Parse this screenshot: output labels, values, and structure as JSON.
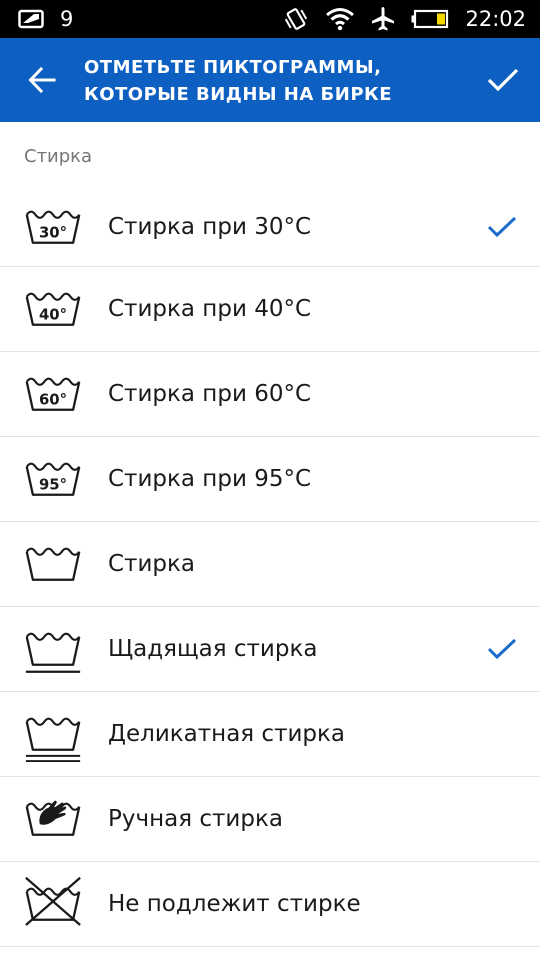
{
  "status_bar": {
    "notification_count": "9",
    "time": "22:02"
  },
  "app_bar": {
    "title_line1": "ОТМЕТЬТЕ ПИКТОГРАММЫ,",
    "title_line2": "КОТОРЫЕ ВИДНЫ НА БИРКЕ",
    "accent_color": "#0d5fc2",
    "check_color": "#1a6ccc"
  },
  "section": {
    "title": "Стирка"
  },
  "items": [
    {
      "label": "Стирка при 30°C",
      "icon": "wash-30-icon",
      "temp": "30°",
      "checked": true
    },
    {
      "label": "Стирка при 40°C",
      "icon": "wash-40-icon",
      "temp": "40°",
      "checked": false
    },
    {
      "label": "Стирка при 60°C",
      "icon": "wash-60-icon",
      "temp": "60°",
      "checked": false
    },
    {
      "label": "Стирка при 95°C",
      "icon": "wash-95-icon",
      "temp": "95°",
      "checked": false
    },
    {
      "label": "Стирка",
      "icon": "wash-icon",
      "checked": false
    },
    {
      "label": "Щадящая стирка",
      "icon": "gentle-wash-icon",
      "checked": true
    },
    {
      "label": "Деликатная стирка",
      "icon": "delicate-wash-icon",
      "checked": false
    },
    {
      "label": "Ручная стирка",
      "icon": "hand-wash-icon",
      "checked": false
    },
    {
      "label": "Не подлежит стирке",
      "icon": "do-not-wash-icon",
      "checked": false
    }
  ]
}
